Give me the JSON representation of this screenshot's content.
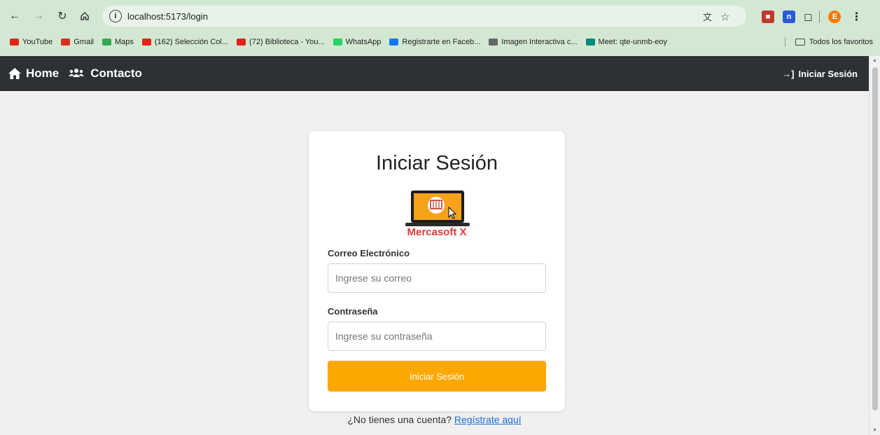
{
  "browser": {
    "url": "localhost:5173/login",
    "bookmarks": [
      {
        "label": "YouTube",
        "color": "#e62117"
      },
      {
        "label": "Gmail",
        "color": "#d93025"
      },
      {
        "label": "Maps",
        "color": "#34a853"
      },
      {
        "label": "(162) Selección Col...",
        "color": "#e62117"
      },
      {
        "label": "(72) Biblioteca - You...",
        "color": "#e62117"
      },
      {
        "label": "WhatsApp",
        "color": "#25d366"
      },
      {
        "label": "Registrarte en Faceb...",
        "color": "#1877f2"
      },
      {
        "label": "Imagen Interactiva c...",
        "color": "#666666"
      },
      {
        "label": "Meet: qte-unmb-eoy",
        "color": "#00897b"
      }
    ],
    "all_bookmarks_label": "Todos los favoritos",
    "profile_initial": "E"
  },
  "nav": {
    "home": "Home",
    "contact": "Contacto",
    "login": "Iniciar Sesión"
  },
  "login": {
    "title": "Iniciar Sesión",
    "logo_text": "Mercasoft X",
    "email_label": "Correo Electrónico",
    "email_placeholder": "Ingrese su correo",
    "password_label": "Contraseña",
    "password_placeholder": "Ingrese su contraseña",
    "submit_label": "Iniciar Sesión",
    "register_prompt": "¿No tienes una cuenta?",
    "register_link": "Regístrate aquí"
  },
  "colors": {
    "navbar": "#2e3134",
    "accent": "#fca702",
    "logo_text": "#e23a3a",
    "link": "#1a6dd8"
  }
}
